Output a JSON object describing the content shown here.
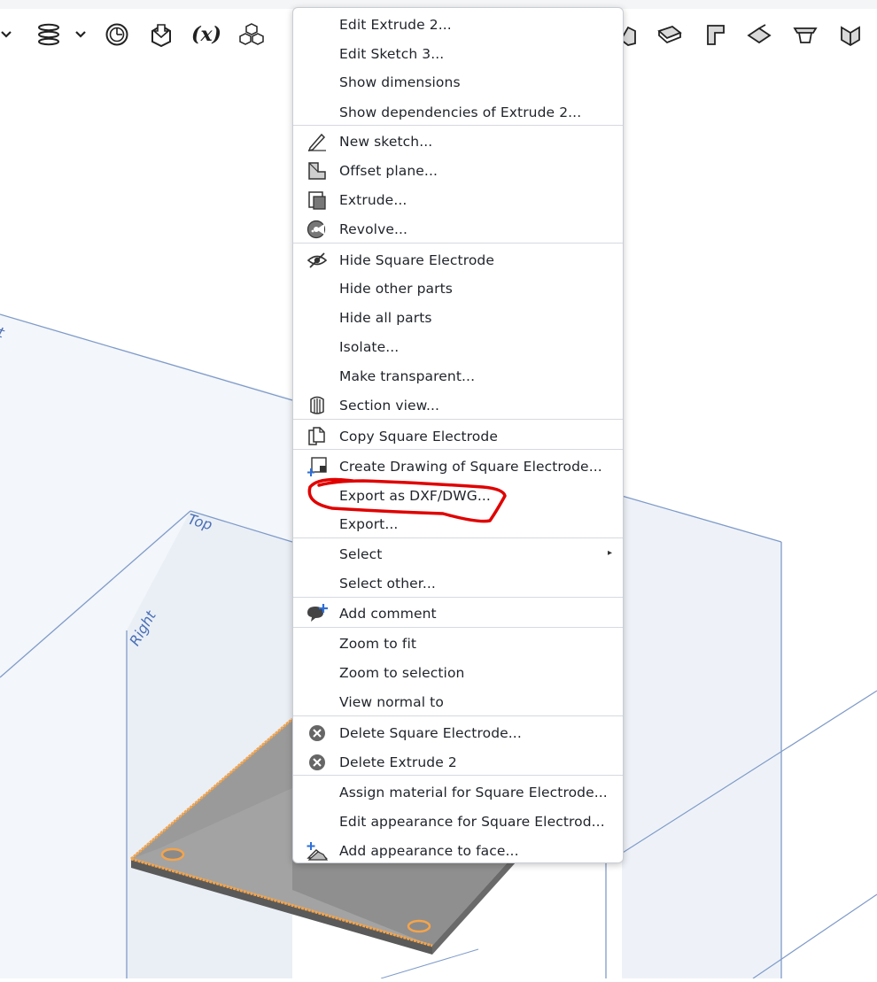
{
  "toolbar": {
    "buttons": [
      {
        "name": "dropdown-chevron-left",
        "icon": "chevron-down-icon"
      },
      {
        "name": "helix-tool",
        "icon": "helix-icon"
      },
      {
        "name": "helix-dropdown",
        "icon": "chevron-down-icon"
      },
      {
        "name": "mate-connector-tool",
        "icon": "clock-icon"
      },
      {
        "name": "insert-tool",
        "icon": "insert-icon"
      },
      {
        "name": "variable-tool",
        "icon": "variable-icon",
        "label": "(x)"
      },
      {
        "name": "parts-tool",
        "icon": "cubes-icon"
      },
      {
        "name": "sheet-metal-flange",
        "icon": "flange-icon"
      },
      {
        "name": "sheet-metal-tab",
        "icon": "tab-icon"
      },
      {
        "name": "sheet-metal-bend",
        "icon": "bend-icon"
      },
      {
        "name": "sheet-metal-corner",
        "icon": "corner-icon"
      },
      {
        "name": "sheet-metal-form",
        "icon": "form-icon"
      },
      {
        "name": "sheet-metal-hem",
        "icon": "hem-icon"
      }
    ]
  },
  "viewport": {
    "plane_labels": {
      "front_partial": "t",
      "top": "Top",
      "right": "Right"
    },
    "colors": {
      "plane_stroke": "#7f9bc9",
      "plane_fill": "#eef2f8",
      "edge_highlight": "#f5a44a",
      "part_fill": "#9a9a9a"
    }
  },
  "context_menu": {
    "groups": [
      {
        "items": [
          {
            "label": "Edit Extrude 2...",
            "icon": ""
          },
          {
            "label": "Edit Sketch 3...",
            "icon": ""
          },
          {
            "label": "Show dimensions",
            "icon": ""
          },
          {
            "label": "Show dependencies of Extrude 2...",
            "icon": ""
          }
        ]
      },
      {
        "items": [
          {
            "label": "New sketch...",
            "icon": "pencil-icon"
          },
          {
            "label": "Offset plane...",
            "icon": "offset-plane-icon"
          },
          {
            "label": "Extrude...",
            "icon": "extrude-icon"
          },
          {
            "label": "Revolve...",
            "icon": "revolve-icon"
          }
        ]
      },
      {
        "items": [
          {
            "label": "Hide Square Electrode",
            "icon": "eye-hide-icon"
          },
          {
            "label": "Hide other parts",
            "icon": ""
          },
          {
            "label": "Hide all parts",
            "icon": ""
          },
          {
            "label": "Isolate...",
            "icon": ""
          },
          {
            "label": "Make transparent...",
            "icon": ""
          },
          {
            "label": "Section view...",
            "icon": "section-view-icon"
          }
        ]
      },
      {
        "items": [
          {
            "label": "Copy Square Electrode",
            "icon": "copy-icon"
          }
        ]
      },
      {
        "items": [
          {
            "label": "Create Drawing of Square Electrode...",
            "icon": "create-drawing-icon"
          },
          {
            "label": "Export as DXF/DWG...",
            "icon": ""
          },
          {
            "label": "Export...",
            "icon": ""
          }
        ]
      },
      {
        "items": [
          {
            "label": "Select",
            "icon": "",
            "submenu": true
          },
          {
            "label": "Select other...",
            "icon": ""
          }
        ]
      },
      {
        "items": [
          {
            "label": "Add comment",
            "icon": "add-comment-icon"
          }
        ]
      },
      {
        "items": [
          {
            "label": "Zoom to fit",
            "icon": ""
          },
          {
            "label": "Zoom to selection",
            "icon": ""
          },
          {
            "label": "View normal to",
            "icon": ""
          }
        ]
      },
      {
        "items": [
          {
            "label": "Delete Square Electrode...",
            "icon": "delete-icon"
          },
          {
            "label": "Delete Extrude 2",
            "icon": "delete-icon"
          }
        ]
      },
      {
        "items": [
          {
            "label": "Assign material for Square Electrode...",
            "icon": ""
          },
          {
            "label": "Edit appearance for Square Electrod...",
            "icon": ""
          },
          {
            "label": "Add appearance to face...",
            "icon": "add-appearance-icon"
          }
        ]
      }
    ],
    "submenu_arrow": "▸",
    "annotation": {
      "type": "red-freehand-circle",
      "target": "Export as DXF/DWG...",
      "color": "#e00000"
    }
  }
}
